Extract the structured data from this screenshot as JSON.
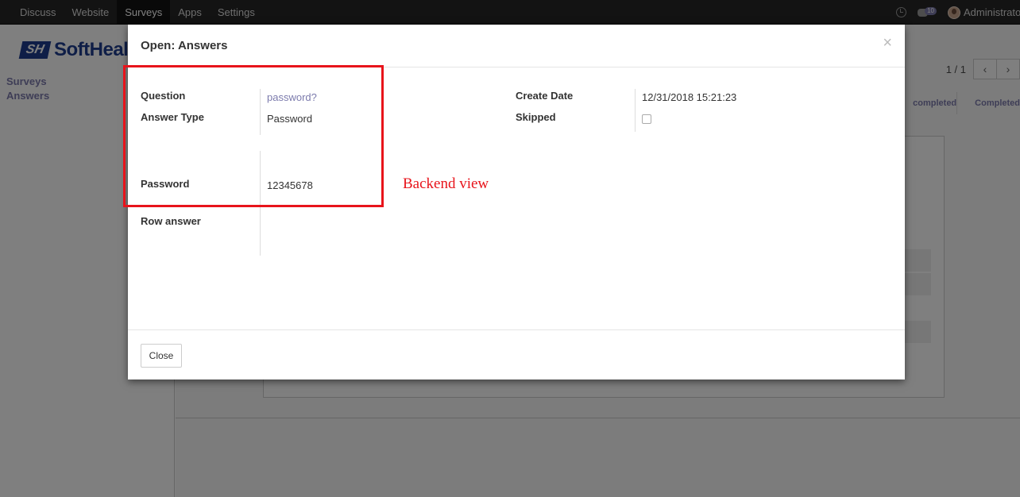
{
  "navbar": {
    "items": [
      "Discuss",
      "Website",
      "Surveys",
      "Apps",
      "Settings"
    ],
    "active": "Surveys",
    "chat_count": "10",
    "user_name": "Administrator"
  },
  "sidebar": {
    "logo_mark": "SH",
    "logo_text": "SoftHealer",
    "links": [
      "Surveys",
      "Answers"
    ]
  },
  "main": {
    "pager": "1 / 1",
    "status_items": [
      "completed",
      "Completed"
    ]
  },
  "modal": {
    "title": "Open: Answers",
    "close_symbol": "×",
    "fields": {
      "question_label": "Question",
      "question_value": "password?",
      "answer_type_label": "Answer Type",
      "answer_type_value": "Password",
      "password_label": "Password",
      "password_value": "12345678",
      "row_answer_label": "Row answer",
      "create_date_label": "Create Date",
      "create_date_value": "12/31/2018 15:21:23",
      "skipped_label": "Skipped",
      "skipped_checked": false
    },
    "close_button": "Close"
  },
  "annotation": {
    "text": "Backend view",
    "color": "#e8141b"
  },
  "colors": {
    "accent": "#7c7bad",
    "navbar": "#262626"
  },
  "icons": {
    "clock": "clock-icon",
    "chat": "chat-icon",
    "close": "close-icon",
    "prev": "chevron-left-icon",
    "next": "chevron-right-icon"
  }
}
